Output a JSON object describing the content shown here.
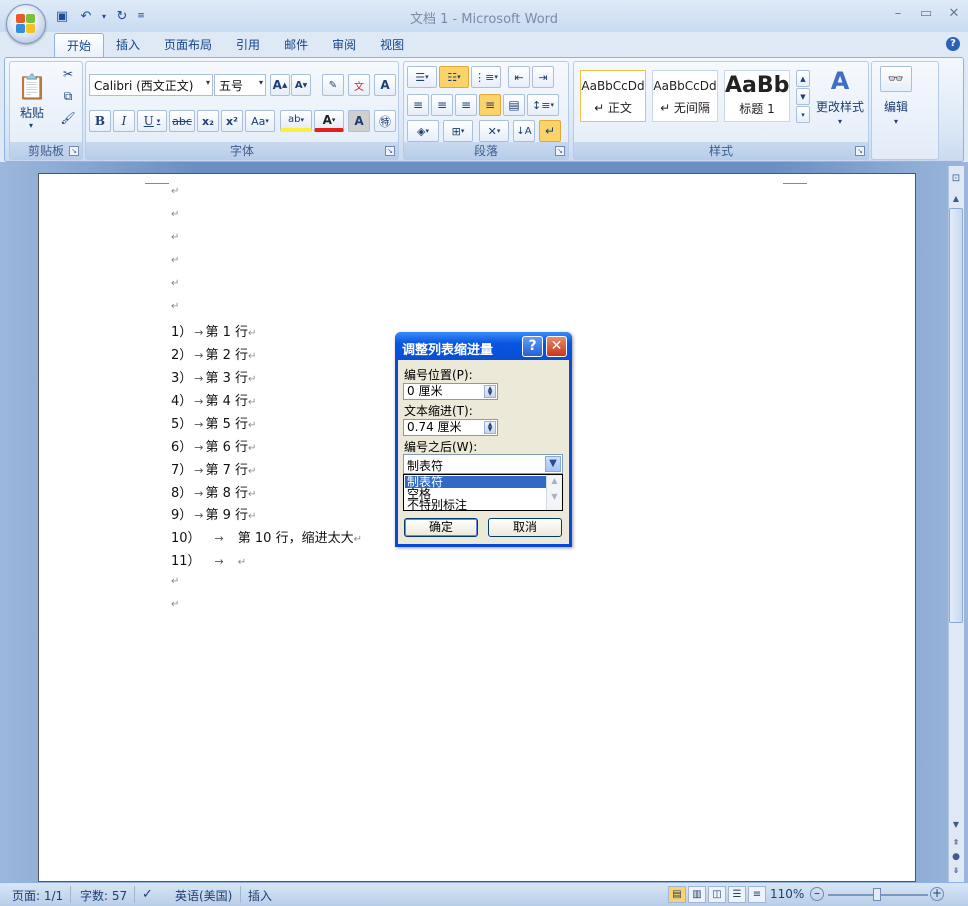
{
  "window": {
    "title": "文档 1 - Microsoft Word"
  },
  "tabs": [
    "开始",
    "插入",
    "页面布局",
    "引用",
    "邮件",
    "审阅",
    "视图"
  ],
  "ribbon": {
    "clipboard": {
      "label": "剪贴板",
      "paste": "粘贴"
    },
    "font": {
      "label": "字体",
      "font_name": "Calibri (西文正文)",
      "font_size": "五号"
    },
    "paragraph": {
      "label": "段落"
    },
    "styles": {
      "label": "样式",
      "tiles": [
        {
          "sample": "AaBbCcDd",
          "name": "↵ 正文"
        },
        {
          "sample": "AaBbCcDd",
          "name": "↵ 无间隔"
        },
        {
          "sample": "AaBb",
          "name": "标题 1"
        }
      ],
      "change_styles": "更改样式"
    },
    "editing": {
      "label": "编辑"
    }
  },
  "document": {
    "lines": [
      {
        "num": "1）",
        "text": "第 1 行"
      },
      {
        "num": "2）",
        "text": "第 2 行"
      },
      {
        "num": "3）",
        "text": "第 3 行"
      },
      {
        "num": "4）",
        "text": "第 4 行"
      },
      {
        "num": "5）",
        "text": "第 5 行"
      },
      {
        "num": "6）",
        "text": "第 6 行"
      },
      {
        "num": "7）",
        "text": "第 7 行"
      },
      {
        "num": "8）",
        "text": "第 8 行"
      },
      {
        "num": "9）",
        "text": "第 9 行"
      },
      {
        "num": "10）",
        "text": "第 10 行，缩进太大"
      },
      {
        "num": "11）",
        "text": ""
      }
    ],
    "para_mark": "↵",
    "tab_arrow": "→"
  },
  "dialog": {
    "title": "调整列表缩进量",
    "number_position_label": "编号位置(P):",
    "number_position_value": "0 厘米",
    "text_indent_label": "文本缩进(T):",
    "text_indent_value": "0.74 厘米",
    "follow_number_label": "编号之后(W):",
    "follow_number_value": "制表符",
    "options": [
      "制表符",
      "空格",
      "不特别标注"
    ],
    "ok": "确定",
    "cancel": "取消"
  },
  "statusbar": {
    "page": "页面: 1/1",
    "words": "字数: 57",
    "language": "英语(美国)",
    "mode": "插入",
    "zoom": "110%"
  }
}
